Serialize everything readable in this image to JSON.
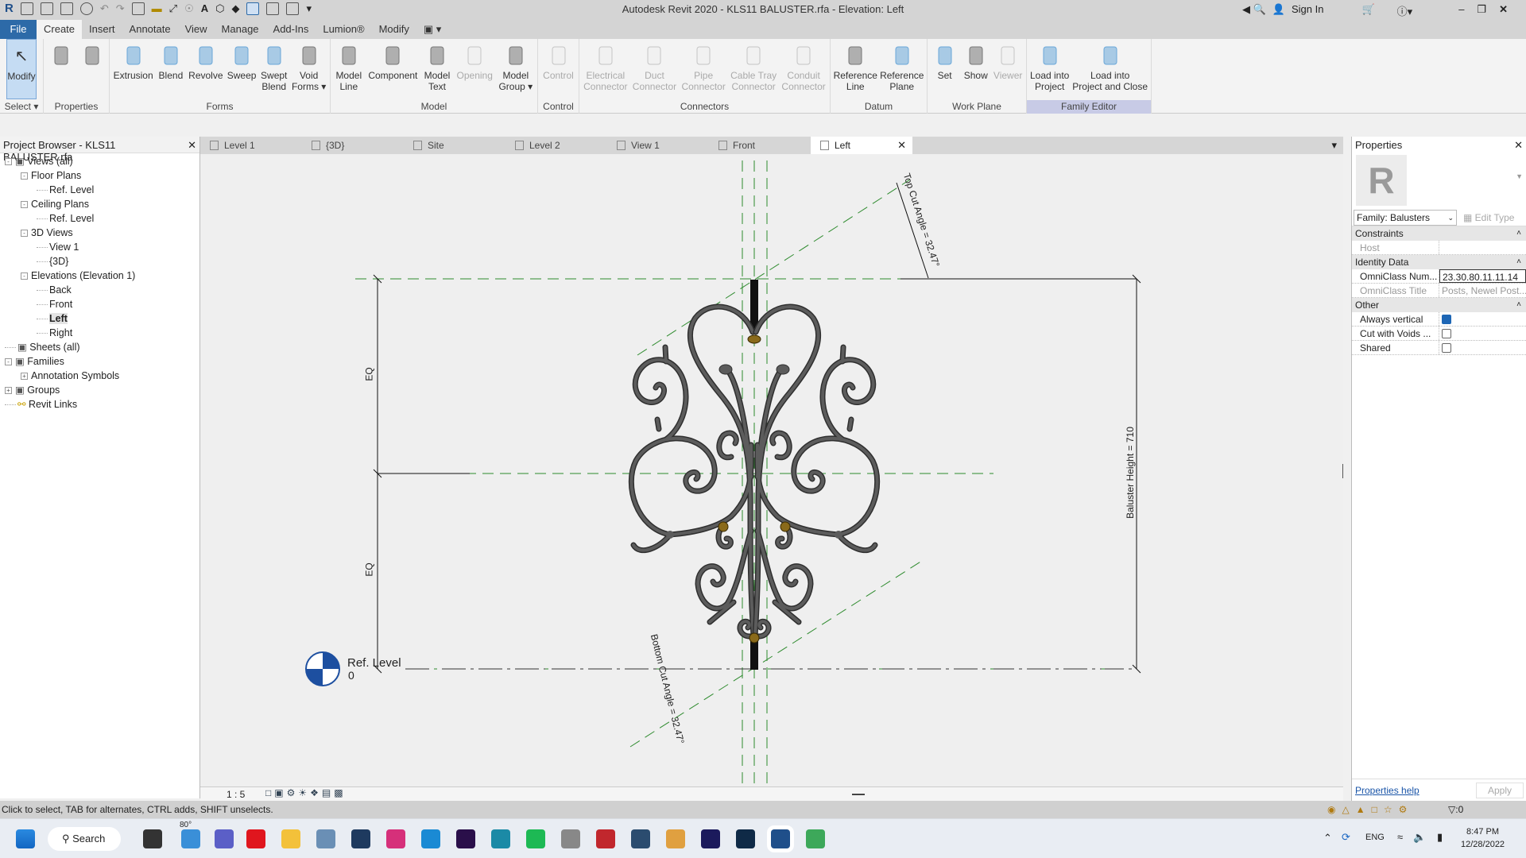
{
  "window": {
    "title": "Autodesk Revit 2020 - KLS11 BALUSTER.rfa - Elevation: Left",
    "sign_in": "Sign In"
  },
  "menu": {
    "tabs": [
      "File",
      "Create",
      "Insert",
      "Annotate",
      "View",
      "Manage",
      "Add-Ins",
      "Lumion®",
      "Modify"
    ],
    "active": "Create"
  },
  "ribbon": {
    "panels": [
      {
        "label": "Select ▾",
        "buttons": [
          {
            "label": "Modify",
            "icon": "cursor-icon",
            "selected": true
          }
        ]
      },
      {
        "label": "Properties",
        "buttons": [
          {
            "label": "",
            "icon": "family-types-icon"
          },
          {
            "label": "",
            "icon": "type-properties-icon"
          }
        ]
      },
      {
        "label": "Forms",
        "buttons": [
          {
            "label": "Extrusion",
            "icon": "extrusion-icon"
          },
          {
            "label": "Blend",
            "icon": "blend-icon"
          },
          {
            "label": "Revolve",
            "icon": "revolve-icon"
          },
          {
            "label": "Sweep",
            "icon": "sweep-icon"
          },
          {
            "label": "Swept\nBlend",
            "icon": "swept-blend-icon"
          },
          {
            "label": "Void\nForms ▾",
            "icon": "void-forms-icon"
          }
        ]
      },
      {
        "label": "Model",
        "buttons": [
          {
            "label": "Model\nLine",
            "icon": "model-line-icon"
          },
          {
            "label": "Component",
            "icon": "component-icon"
          },
          {
            "label": "Model\nText",
            "icon": "model-text-icon"
          },
          {
            "label": "Opening",
            "icon": "opening-icon",
            "disabled": true
          },
          {
            "label": "Model\nGroup ▾",
            "icon": "model-group-icon"
          }
        ]
      },
      {
        "label": "Control",
        "buttons": [
          {
            "label": "Control",
            "icon": "control-icon",
            "disabled": true
          }
        ]
      },
      {
        "label": "Connectors",
        "buttons": [
          {
            "label": "Electrical\nConnector",
            "icon": "electrical-connector-icon",
            "disabled": true
          },
          {
            "label": "Duct\nConnector",
            "icon": "duct-connector-icon",
            "disabled": true
          },
          {
            "label": "Pipe\nConnector",
            "icon": "pipe-connector-icon",
            "disabled": true
          },
          {
            "label": "Cable Tray\nConnector",
            "icon": "cable-tray-connector-icon",
            "disabled": true
          },
          {
            "label": "Conduit\nConnector",
            "icon": "conduit-connector-icon",
            "disabled": true
          }
        ]
      },
      {
        "label": "Datum",
        "buttons": [
          {
            "label": "Reference\nLine",
            "icon": "reference-line-icon"
          },
          {
            "label": "Reference\nPlane",
            "icon": "reference-plane-icon"
          }
        ]
      },
      {
        "label": "Work Plane",
        "buttons": [
          {
            "label": "Set",
            "icon": "set-workplane-icon"
          },
          {
            "label": "Show",
            "icon": "show-workplane-icon"
          },
          {
            "label": "Viewer",
            "icon": "viewer-icon",
            "disabled": true
          }
        ]
      },
      {
        "label": "Family Editor",
        "buttons": [
          {
            "label": "Load into\nProject",
            "icon": "load-into-project-icon"
          },
          {
            "label": "Load into\nProject and Close",
            "icon": "load-and-close-icon"
          }
        ]
      }
    ]
  },
  "browser": {
    "title": "Project Browser - KLS11 BALUSTER.rfa",
    "items": [
      {
        "label": "Views (all)",
        "level": 0,
        "toggle": "-"
      },
      {
        "label": "Floor Plans",
        "level": 1,
        "toggle": "-"
      },
      {
        "label": "Ref. Level",
        "level": 2
      },
      {
        "label": "Ceiling Plans",
        "level": 1,
        "toggle": "-"
      },
      {
        "label": "Ref. Level",
        "level": 2
      },
      {
        "label": "3D Views",
        "level": 1,
        "toggle": "-"
      },
      {
        "label": "View 1",
        "level": 2
      },
      {
        "label": "{3D}",
        "level": 2
      },
      {
        "label": "Elevations (Elevation 1)",
        "level": 1,
        "toggle": "-"
      },
      {
        "label": "Back",
        "level": 2
      },
      {
        "label": "Front",
        "level": 2
      },
      {
        "label": "Left",
        "level": 2,
        "selected": true
      },
      {
        "label": "Right",
        "level": 2
      },
      {
        "label": "Sheets (all)",
        "level": 0
      },
      {
        "label": "Families",
        "level": 0,
        "toggle": "-"
      },
      {
        "label": "Annotation Symbols",
        "level": 1,
        "toggle": "+"
      },
      {
        "label": "Groups",
        "level": 0,
        "toggle": "+"
      },
      {
        "label": "Revit Links",
        "level": 0
      }
    ]
  },
  "view_tabs": [
    {
      "label": "Level 1"
    },
    {
      "label": "{3D}"
    },
    {
      "label": "Site"
    },
    {
      "label": "Level 2"
    },
    {
      "label": "View 1"
    },
    {
      "label": "Front"
    },
    {
      "label": "Left",
      "active": true
    }
  ],
  "drawing": {
    "eq_label": "EQ",
    "height_dim": "Baluster Height = 710",
    "top_cut": "Top Cut Angle = 32.47°",
    "bottom_cut": "Bottom Cut Angle = 32.47°",
    "level_name": "Ref. Level",
    "level_value": "0",
    "scale": "1 : 5"
  },
  "properties": {
    "title": "Properties",
    "family_selector": "Family: Balusters",
    "edit_type": "Edit Type",
    "groups": [
      {
        "name": "Constraints",
        "rows": [
          {
            "k": "Host",
            "v": "",
            "disabled": true
          }
        ]
      },
      {
        "name": "Identity Data",
        "rows": [
          {
            "k": "OmniClass Num...",
            "v": "23.30.80.11.11.14",
            "edit": true
          },
          {
            "k": "OmniClass Title",
            "v": "Posts, Newel Post...",
            "disabled": true
          }
        ]
      },
      {
        "name": "Other",
        "rows": [
          {
            "k": "Always vertical",
            "check": true
          },
          {
            "k": "Cut with Voids ...",
            "check": false
          },
          {
            "k": "Shared",
            "check": false
          }
        ]
      }
    ],
    "help": "Properties help",
    "apply": "Apply"
  },
  "status": {
    "text": "Click to select, TAB for alternates, CTRL adds, SHIFT unselects.",
    "filter_count": ":0"
  },
  "taskbar": {
    "search": "Search",
    "weather": "80°",
    "lang": "ENG",
    "time": "8:47 PM",
    "date": "12/28/2022",
    "apps": [
      {
        "name": "task-view",
        "color": "#333"
      },
      {
        "name": "weather",
        "color": "#3a8fd8"
      },
      {
        "name": "teams",
        "color": "#5b5fc7"
      },
      {
        "name": "opera",
        "color": "#e0161e"
      },
      {
        "name": "file-explorer",
        "color": "#f3c13a"
      },
      {
        "name": "monitor",
        "color": "#6a8fb5"
      },
      {
        "name": "lightroom-classic",
        "color": "#1e3a5f"
      },
      {
        "name": "instagram",
        "color": "#d6307a"
      },
      {
        "name": "edge",
        "color": "#1a8ad4"
      },
      {
        "name": "premiere",
        "color": "#2a0f4a"
      },
      {
        "name": "3ds-max",
        "color": "#1b8aa6"
      },
      {
        "name": "spotify",
        "color": "#1db954"
      },
      {
        "name": "scanner",
        "color": "#888"
      },
      {
        "name": "autocad",
        "color": "#c1272d"
      },
      {
        "name": "app-12",
        "color": "#2b4c6f"
      },
      {
        "name": "media-player",
        "color": "#e0a040"
      },
      {
        "name": "after-effects",
        "color": "#1b1a5c"
      },
      {
        "name": "photoshop",
        "color": "#0f2a47"
      },
      {
        "name": "revit",
        "color": "#1f4f8a"
      },
      {
        "name": "maps",
        "color": "#3da85a"
      }
    ]
  }
}
